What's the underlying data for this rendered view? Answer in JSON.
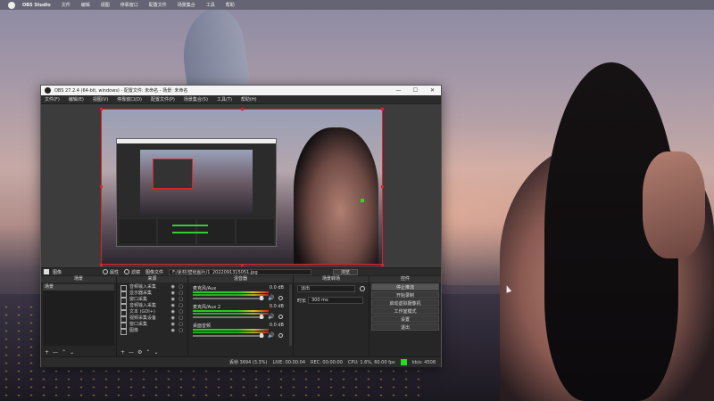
{
  "menubar": {
    "app": "OBS Studio",
    "items": [
      "文件",
      "编辑",
      "视图",
      "停靠窗口",
      "配置文件",
      "场景集合",
      "工具",
      "帮助"
    ]
  },
  "window": {
    "title": "OBS 27.2.4 (64-bit, windows) - 配置文件: 未命名 - 场景: 未命名",
    "controls": [
      "—",
      "☐",
      "✕"
    ],
    "menu": [
      "文件(F)",
      "编辑(E)",
      "视图(V)",
      "停靠窗口(D)",
      "配置文件(P)",
      "场景集合(S)",
      "工具(T)",
      "帮助(H)"
    ]
  },
  "source_toolbar": {
    "source_label": "图像",
    "properties": "属性",
    "filters": "滤镜",
    "image_file_label": "图像文件",
    "path": "F:/素材/壁纸图片/1_2022091315051.jpg",
    "browse": "浏览"
  },
  "scenes": {
    "header": "场景",
    "items": [
      "场景"
    ],
    "footer": [
      "+",
      "—",
      "⌃",
      "⌄"
    ]
  },
  "sources": {
    "header": "来源",
    "items": [
      "音频输入采集",
      "显示器采集",
      "窗口采集",
      "音频输入采集",
      "文本 (GDI+)",
      "视频采集设备",
      "窗口采集",
      "图像"
    ],
    "footer": [
      "+",
      "—",
      "⚙",
      "⌃",
      "⌄"
    ]
  },
  "mixer": {
    "header": "混音器",
    "channels": [
      {
        "name": "麦克风/Aux",
        "db": "0.0 dB"
      },
      {
        "name": "麦克风/Aux 2",
        "db": "0.0 dB"
      },
      {
        "name": "桌面音频",
        "db": "0.0 dB"
      }
    ]
  },
  "transitions": {
    "header": "场景转场",
    "type": "淡出",
    "duration_label": "时长",
    "duration": "300 ms"
  },
  "controls": {
    "header": "控件",
    "buttons": [
      "停止推流",
      "开始录制",
      "启动虚拟摄像机",
      "工作室模式",
      "设置",
      "退出"
    ]
  },
  "status": {
    "dropped": "丢帧 3694 (3.3%)",
    "live": "LIVE: 00:00:04",
    "rec": "REC: 00:00:00",
    "cpu": "CPU: 1.6%, 60.00 fps",
    "kbps": "kb/s: 4508"
  },
  "colors": {
    "accent_red": "#e0202a",
    "streaming_green": "#22dd22"
  }
}
